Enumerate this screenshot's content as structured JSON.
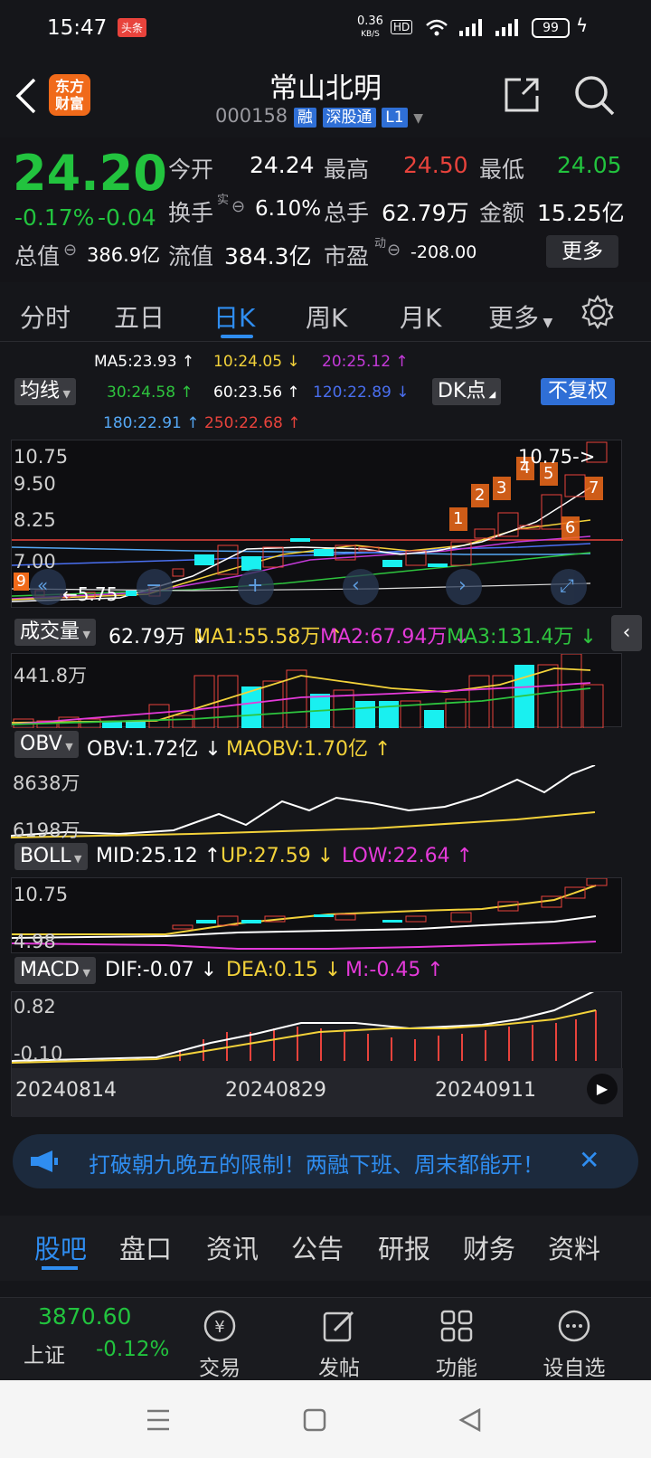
{
  "status": {
    "time": "15:47",
    "badge": "头条",
    "net_speed": "0.36",
    "net_unit": "KB/S",
    "hd": "HD",
    "battery": "99"
  },
  "header": {
    "logo_line1": "东方",
    "logo_line2": "财富",
    "title": "常山北明",
    "code": "000158",
    "tag1": "融",
    "tag2": "深股通",
    "tag3": "L1"
  },
  "quote": {
    "price": "24.20",
    "change_pct": "-0.17%",
    "change": "-0.04",
    "open_label": "今开",
    "open": "24.24",
    "high_label": "最高",
    "high": "24.50",
    "low_label": "最低",
    "low": "24.05",
    "turnover_label": "换手",
    "turnover_sup": "实",
    "turnover": "6.10%",
    "volume_label": "总手",
    "volume": "62.79万",
    "amount_label": "金额",
    "amount": "15.25亿",
    "mktcap_label": "总值",
    "mktcap": "386.9亿",
    "float_label": "流值",
    "float": "384.3亿",
    "pe_label": "市盈",
    "pe_sup": "动",
    "pe": "-208.00",
    "more": "更多"
  },
  "tabs": [
    "分时",
    "五日",
    "日K",
    "周K",
    "月K",
    "更多"
  ],
  "active_tab": 2,
  "ma_panel": {
    "selector": "均线",
    "dk": "DK点",
    "restore": "不复权",
    "ma5": "MA5:23.93 ↑",
    "ma10": "10:24.05 ↓",
    "ma20": "20:25.12 ↑",
    "ma30": "30:24.58 ↑",
    "ma60": "60:23.56 ↑",
    "ma120": "120:22.89 ↓",
    "ma180": "180:22.91 ↑",
    "ma250": "250:22.68 ↑"
  },
  "kline": {
    "y_top": "10.75",
    "y2": "9.50",
    "y3": "8.25",
    "y4": "7.00",
    "y5": "5.75",
    "high_mark": "10.75->",
    "low_mark": "5.75",
    "side_badge": "9",
    "signals": [
      "1",
      "2",
      "3",
      "4",
      "5",
      "7",
      "6"
    ]
  },
  "volume_panel": {
    "selector": "成交量",
    "vol": "62.79万 ↓",
    "ma1": "MA1:55.58万 ↑",
    "ma2": "MA2:67.94万 ↓",
    "ma3": "MA3:131.4万 ↓",
    "y_top": "441.8万"
  },
  "obv_panel": {
    "selector": "OBV",
    "obv": "OBV:1.72亿 ↓",
    "maobv": "MAOBV:1.70亿 ↑",
    "y_top": "8638万",
    "y_bot": "6198万"
  },
  "boll_panel": {
    "selector": "BOLL",
    "mid": "MID:25.12 ↑",
    "up": "UP:27.59 ↓",
    "low": "LOW:22.64 ↑",
    "y_top": "10.75",
    "y_bot": "4.98"
  },
  "macd_panel": {
    "selector": "MACD",
    "dif": "DIF:-0.07 ↓",
    "dea": "DEA:0.15 ↓",
    "m": "M:-0.45 ↑",
    "y_top": "0.82",
    "y_bot": "-0.10"
  },
  "dates": [
    "20240814",
    "20240829",
    "20240911"
  ],
  "banner": {
    "text": "打破朝九晚五的限制！两融下班、周末都能开！"
  },
  "bottom_tabs": [
    "股吧",
    "盘口",
    "资讯",
    "公告",
    "研报",
    "财务",
    "资料"
  ],
  "footer": {
    "index_value": "3870.60",
    "index_name": "上证",
    "index_change": "-0.12%",
    "buttons": [
      "交易",
      "发帖",
      "功能",
      "设自选"
    ]
  },
  "colors": {
    "up": "#e8433c",
    "down": "#22c33e",
    "accent": "#2f8df0",
    "cyan": "#19f0f0",
    "yellow": "#f3d23a",
    "magenta": "#e43ad9"
  }
}
